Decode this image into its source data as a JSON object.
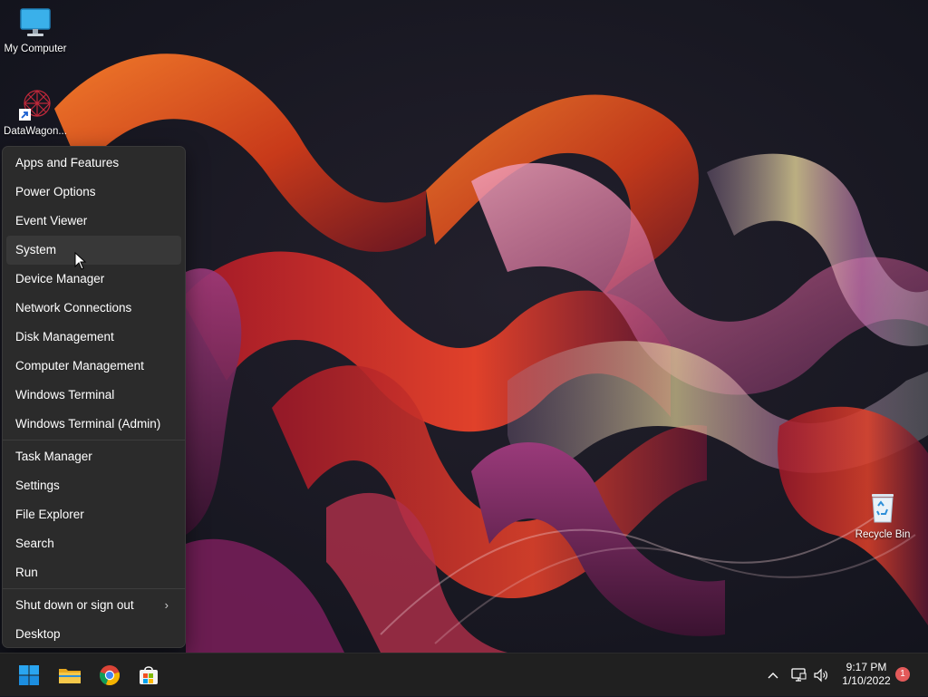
{
  "desktop": {
    "icons": [
      {
        "label": "My Computer",
        "icon": "monitor-icon"
      },
      {
        "label": "DataWagon...",
        "icon": "datawagon-shortcut-icon"
      },
      {
        "label": "Recycle Bin",
        "icon": "recycle-bin-icon"
      }
    ]
  },
  "context_menu": {
    "group1": [
      {
        "label": "Apps and Features"
      },
      {
        "label": "Power Options"
      },
      {
        "label": "Event Viewer"
      },
      {
        "label": "System"
      },
      {
        "label": "Device Manager"
      },
      {
        "label": "Network Connections"
      },
      {
        "label": "Disk Management"
      },
      {
        "label": "Computer Management"
      },
      {
        "label": "Windows Terminal"
      },
      {
        "label": "Windows Terminal (Admin)"
      }
    ],
    "group2": [
      {
        "label": "Task Manager"
      },
      {
        "label": "Settings"
      },
      {
        "label": "File Explorer"
      },
      {
        "label": "Search"
      },
      {
        "label": "Run"
      }
    ],
    "group3": [
      {
        "label": "Shut down or sign out",
        "submenu_icon": "chevron-right-icon"
      },
      {
        "label": "Desktop"
      }
    ],
    "hovered_item": "System"
  },
  "taskbar": {
    "apps": [
      {
        "icon": "windows-start-icon"
      },
      {
        "icon": "file-explorer-icon"
      },
      {
        "icon": "chrome-icon"
      },
      {
        "icon": "microsoft-store-icon"
      }
    ],
    "tray": {
      "icons": [
        "chevron-up-icon",
        "network-icon",
        "volume-icon"
      ],
      "time": "9:17 PM",
      "date": "1/10/2022",
      "notification_count": "1"
    }
  },
  "colors": {
    "menu_bg": "#2b2b2b",
    "taskbar_bg": "#202020",
    "accent_blue": "#0078d4",
    "badge": "#e35a5a"
  }
}
